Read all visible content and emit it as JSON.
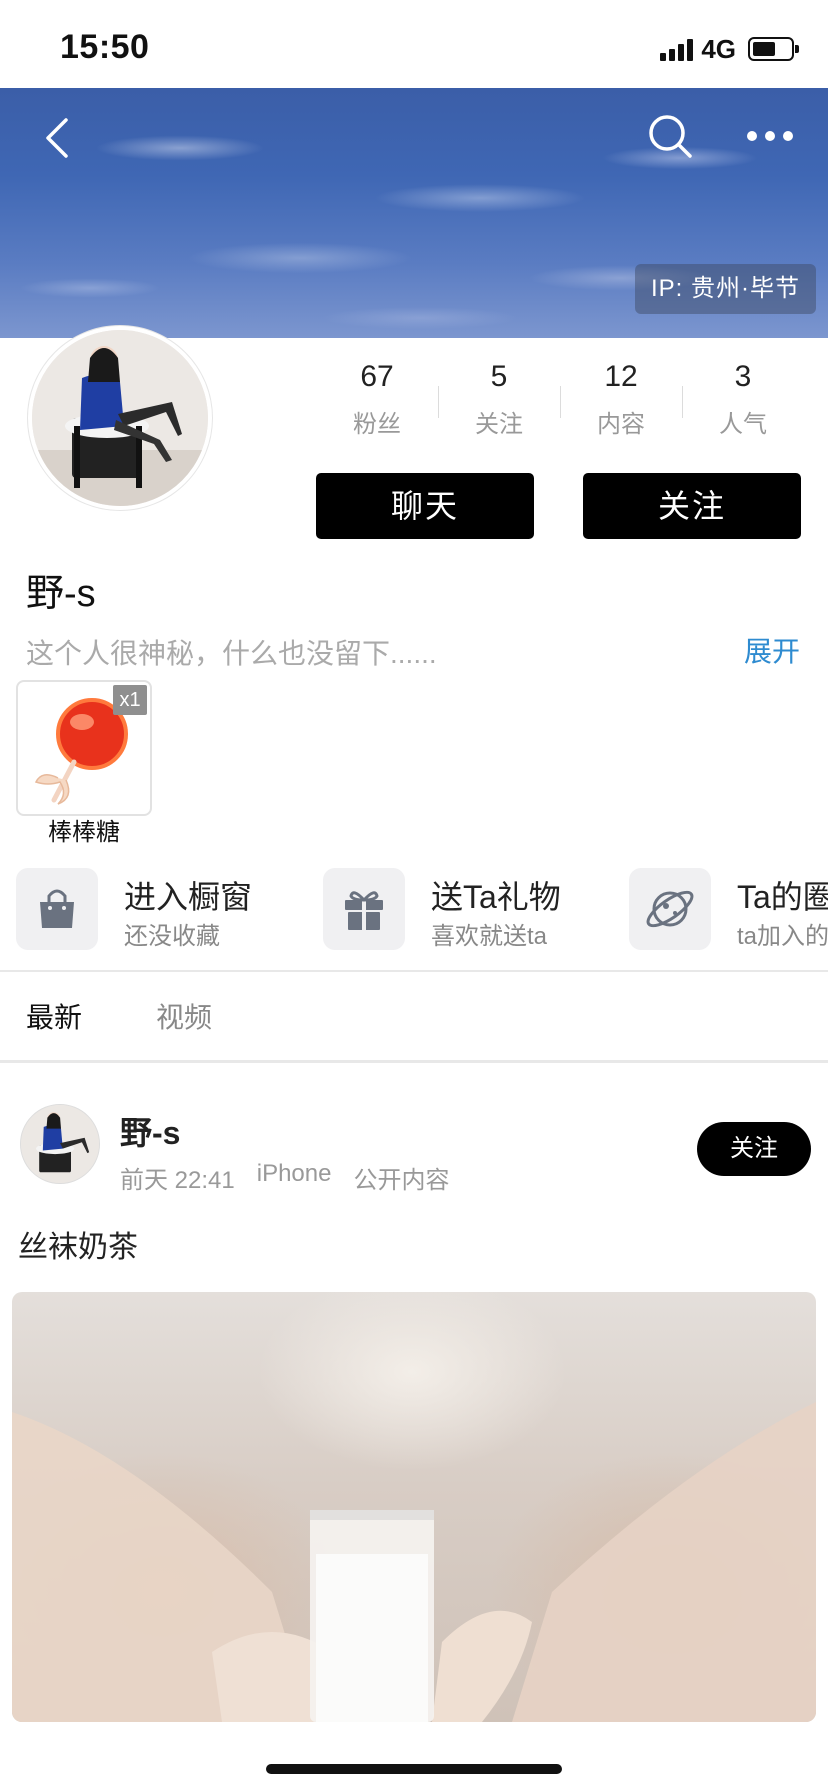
{
  "status_bar": {
    "time": "15:50",
    "network": "4G",
    "battery_level": 0.6
  },
  "header": {
    "ip_location": "IP: 贵州·毕节",
    "icons": [
      "back-icon",
      "search-icon",
      "more-icon"
    ]
  },
  "profile": {
    "username": "野-s",
    "bio": "这个人很神秘，什么也没留下......",
    "expand_label": "展开",
    "stats": [
      {
        "value": "67",
        "label": "粉丝"
      },
      {
        "value": "5",
        "label": "关注"
      },
      {
        "value": "12",
        "label": "内容"
      },
      {
        "value": "3",
        "label": "人气"
      }
    ],
    "chat_label": "聊天",
    "follow_label": "关注"
  },
  "gift": {
    "name": "棒棒糖",
    "count": "x1"
  },
  "features": [
    {
      "title": "进入橱窗",
      "subtitle": "还没收藏",
      "icon": "shopping-bag-icon"
    },
    {
      "title": "送Ta礼物",
      "subtitle": "喜欢就送ta",
      "icon": "gift-icon"
    },
    {
      "title": "Ta的圈",
      "subtitle": "ta加入的",
      "icon": "planet-icon"
    }
  ],
  "tabs": [
    {
      "label": "最新"
    },
    {
      "label": "视频"
    }
  ],
  "post": {
    "author": "野-s",
    "time": "前天 22:41",
    "device": "iPhone",
    "visibility": "公开内容",
    "follow_label": "关注",
    "text": "丝袜奶茶"
  },
  "colors": {
    "accent_link": "#2e8bd0",
    "button_bg": "#000000",
    "banner_sky": "#3f67b4"
  }
}
